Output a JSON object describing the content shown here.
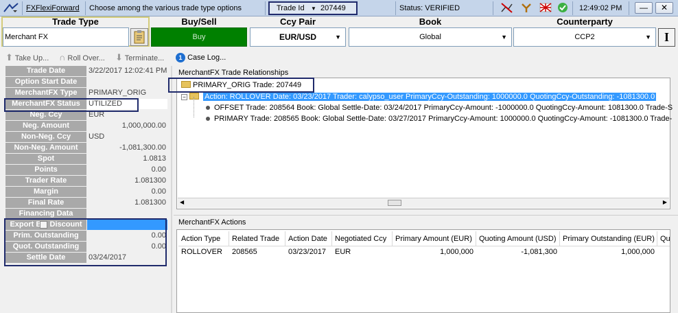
{
  "topbar": {
    "app_link": "FXFlexiForward",
    "hint": "Choose among the various trade type options",
    "id_type": "Trade Id",
    "trade_id": "207449",
    "status": "Status: VERIFIED",
    "clock": "12:49:02 PM",
    "minimize": "—",
    "close": "✕"
  },
  "header": {
    "trade_type_label": "Trade Type",
    "trade_type_value": "Merchant FX",
    "buysell_label": "Buy/Sell",
    "buysell_value": "Buy",
    "ccypair_label": "Ccy Pair",
    "ccypair_value": "EUR/USD",
    "book_label": "Book",
    "book_value": "Global",
    "counterparty_label": "Counterparty",
    "counterparty_value": "CCP2",
    "buy_color": "#008000"
  },
  "toolbar": {
    "take_up": "Take Up...",
    "roll_over": "Roll Over...",
    "terminate": "Terminate...",
    "case_log_count": "1",
    "case_log": "Case Log..."
  },
  "fields": [
    {
      "label": "Trade Date",
      "value": "3/22/2017 12:02:41 PM",
      "align": "left"
    },
    {
      "label": "Option Start Date",
      "value": "",
      "align": "left"
    },
    {
      "label": "MerchantFX Type",
      "value": "PRIMARY_ORIG",
      "align": "left"
    },
    {
      "label": "MerchantFX Status",
      "value": "UTILIZED",
      "align": "left"
    },
    {
      "label": "Neg. Ccy",
      "value": "EUR",
      "align": "left"
    },
    {
      "label": "Neg. Amount",
      "value": "1,000,000.00",
      "align": "right"
    },
    {
      "label": "Non-Neg. Ccy",
      "value": "USD",
      "align": "left"
    },
    {
      "label": "Non-Neg. Amount",
      "value": "-1,081,300.00",
      "align": "right"
    },
    {
      "label": "Spot",
      "value": "1.0813",
      "align": "right"
    },
    {
      "label": "Points",
      "value": "0.00",
      "align": "right"
    },
    {
      "label": "Trader Rate",
      "value": "1.081300",
      "align": "right"
    },
    {
      "label": "Margin",
      "value": "0.00",
      "align": "right"
    },
    {
      "label": "Final Rate",
      "value": "1.081300",
      "align": "right"
    },
    {
      "label": "Financing Data",
      "value": "",
      "align": "left"
    },
    {
      "label": "Export Bill Discount",
      "value": "",
      "align": "left"
    },
    {
      "label": "Prim. Outstanding",
      "value": "0.00",
      "align": "right"
    },
    {
      "label": "Quot. Outstanding",
      "value": "0.00",
      "align": "right"
    },
    {
      "label": "Settle Date",
      "value": "03/24/2017",
      "align": "left"
    }
  ],
  "relationships": {
    "title": "MerchantFX Trade Relationships",
    "root": "PRIMARY_ORIG Trade: 207449",
    "action": "Action: ROLLOVER Date: 03/23/2017 Trader: calypso_user PrimaryCcy-Outstanding: 1000000.0 QuotingCcy-Outstanding: -1081300.0",
    "offset": "OFFSET Trade: 208564 Book: Global Settle-Date: 03/24/2017 PrimaryCcy-Amount: -1000000.0 QuotingCcy-Amount: 1081300.0 Trade-S",
    "primary": "PRIMARY Trade: 208565 Book: Global Settle-Date: 03/27/2017 PrimaryCcy-Amount: 1000000.0 QuotingCcy-Amount: -1081300.0 Trade-"
  },
  "actions": {
    "title": "MerchantFX Actions",
    "columns": [
      "Action Type",
      "Related Trade",
      "Action Date",
      "Negotiated Ccy",
      "Primary Amount (EUR)",
      "Quoting Amount (USD)",
      "Primary Outstanding (EUR)",
      "Qu"
    ],
    "rows": [
      [
        "ROLLOVER",
        "208565",
        "03/23/2017",
        "EUR",
        "1,000,000",
        "-1,081,300",
        "1,000,000",
        ""
      ]
    ]
  }
}
